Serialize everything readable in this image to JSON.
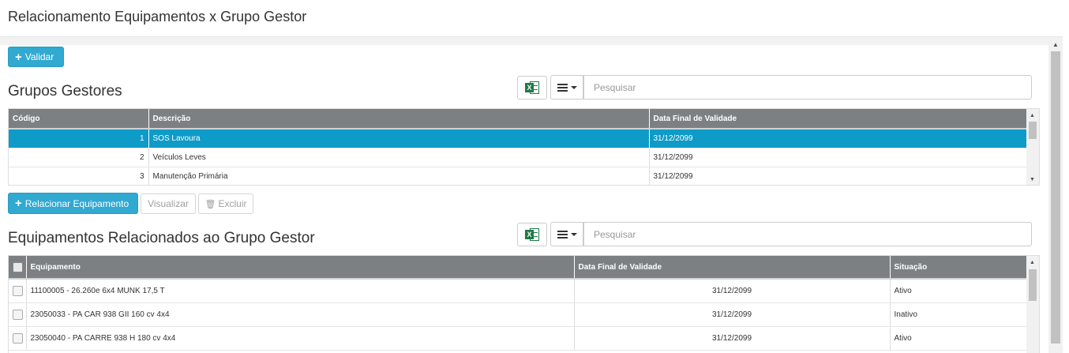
{
  "page": {
    "title": "Relacionamento Equipamentos x Grupo Gestor"
  },
  "toolbar": {
    "validar_label": "Validar"
  },
  "groups": {
    "title": "Grupos Gestores",
    "search_placeholder": "Pesquisar",
    "columns": [
      "Código",
      "Descrição",
      "Data Final de Validade"
    ],
    "rows": [
      {
        "codigo": "1",
        "descricao": "SOS Lavoura",
        "data": "31/12/2099",
        "selected": true
      },
      {
        "codigo": "2",
        "descricao": "Veículos Leves",
        "data": "31/12/2099",
        "selected": false
      },
      {
        "codigo": "3",
        "descricao": "Manutenção Primária",
        "data": "31/12/2099",
        "selected": false
      }
    ]
  },
  "actions": {
    "relacionar_label": "Relacionar Equipamento",
    "visualizar_label": "Visualizar",
    "excluir_label": "Excluir"
  },
  "equipments": {
    "title": "Equipamentos Relacionados ao Grupo Gestor",
    "search_placeholder": "Pesquisar",
    "columns": [
      "Equipamento",
      "Data Final de Validade",
      "Situação"
    ],
    "rows": [
      {
        "equipamento": "11100005 - 26.260e 6x4 MUNK 17,5 T",
        "data": "31/12/2099",
        "situacao": "Ativo"
      },
      {
        "equipamento": "23050033 - PA CAR 938 GII 160 cv 4x4",
        "data": "31/12/2099",
        "situacao": "Inativo"
      },
      {
        "equipamento": "23050040 - PA CARRE 938 H 180 cv 4x4",
        "data": "31/12/2099",
        "situacao": "Ativo"
      }
    ]
  },
  "icons": {
    "plus": "plus-icon",
    "excel": "excel-icon",
    "columns": "columns-menu-icon",
    "trash": "trash-icon"
  },
  "colors": {
    "primary": "#31a9d1",
    "selected_row": "#0e9bc7",
    "header_bg": "#7c8083",
    "excel_green": "#1e7a45"
  }
}
